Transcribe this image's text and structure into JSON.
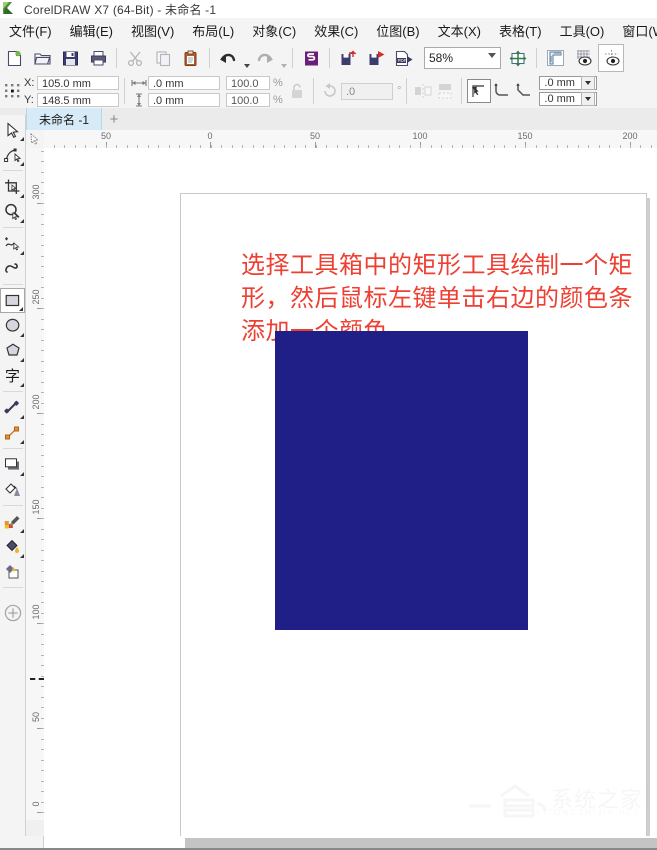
{
  "window": {
    "title": "CorelDRAW X7 (64-Bit) - 未命名 -1",
    "logo_icon": "coreldraw-logo-icon"
  },
  "menubar": {
    "items": [
      {
        "label": "文件(F)",
        "name": "menu-file"
      },
      {
        "label": "编辑(E)",
        "name": "menu-edit"
      },
      {
        "label": "视图(V)",
        "name": "menu-view"
      },
      {
        "label": "布局(L)",
        "name": "menu-layout"
      },
      {
        "label": "对象(C)",
        "name": "menu-object"
      },
      {
        "label": "效果(C)",
        "name": "menu-effects"
      },
      {
        "label": "位图(B)",
        "name": "menu-bitmap"
      },
      {
        "label": "文本(X)",
        "name": "menu-text"
      },
      {
        "label": "表格(T)",
        "name": "menu-table"
      },
      {
        "label": "工具(O)",
        "name": "menu-tools"
      },
      {
        "label": "窗口(W)",
        "name": "menu-window"
      }
    ]
  },
  "toolbar": {
    "new_icon": "new-document-icon",
    "open_icon": "open-folder-icon",
    "save_icon": "save-floppy-icon",
    "print_icon": "print-icon",
    "cut_icon": "scissors-icon",
    "copy_icon": "copy-icon",
    "paste_icon": "paste-clipboard-icon",
    "undo_icon": "undo-arrow-icon",
    "redo_icon": "redo-arrow-icon",
    "corel_connect_icon": "corel-connect-icon",
    "import_icon": "import-icon",
    "export_icon": "export-icon",
    "publish_pdf_icon": "publish-to-pdf-icon",
    "zoom_value": "58%",
    "zoom_placeholder": "58%",
    "fullscreen_icon": "zoom-levels-icon",
    "options_icon": "options-ruler-icon",
    "grid_icon": "show-grid-icon",
    "snap_icon": "snap-to-icon"
  },
  "propertybar": {
    "position_icon": "object-position-icon",
    "x_label": "X:",
    "x_value": "105.0 mm",
    "y_label": "Y:",
    "y_value": "148.5 mm",
    "width_icon": "object-width-icon",
    "width_value": ".0 mm",
    "height_icon": "object-height-icon",
    "height_value": ".0 mm",
    "scale_x_value": "100.0",
    "scale_y_value": "100.0",
    "percent_symbol": "%",
    "lock_ratio_icon": "lock-ratio-icon",
    "rotate_icon": "rotation-angle-icon",
    "rotate_value": ".0",
    "degree_symbol": "°",
    "mirror_h_icon": "mirror-horizontal-icon",
    "mirror_v_icon": "mirror-vertical-icon",
    "corner_square_icon": "square-corner-icon",
    "corner_round_icon": "round-corner-icon",
    "corner_chamfer_icon": "chamfer-corner-icon",
    "corner_radius_1": ".0 mm",
    "corner_radius_2": ".0 mm"
  },
  "tabbar": {
    "active_tab": "未命名 -1",
    "new_tab_label": "+"
  },
  "toolbox": {
    "items": [
      {
        "name": "tool-pick",
        "icon": "pick-arrow-icon",
        "flyout": true,
        "active": false
      },
      {
        "name": "tool-shape",
        "icon": "shape-node-edit-icon",
        "flyout": true,
        "active": false
      },
      {
        "name": "tool-crop",
        "icon": "crop-icon",
        "flyout": true,
        "active": false
      },
      {
        "name": "tool-zoom",
        "icon": "magnifier-icon",
        "flyout": true,
        "active": false
      },
      {
        "name": "tool-freehand",
        "icon": "freehand-curve-icon",
        "flyout": true,
        "active": false
      },
      {
        "name": "tool-artistic-media",
        "icon": "artistic-media-icon",
        "flyout": false,
        "active": false
      },
      {
        "name": "tool-rectangle",
        "icon": "rectangle-icon",
        "flyout": true,
        "active": true
      },
      {
        "name": "tool-ellipse",
        "icon": "ellipse-icon",
        "flyout": true,
        "active": false
      },
      {
        "name": "tool-polygon",
        "icon": "polygon-icon",
        "flyout": true,
        "active": false
      },
      {
        "name": "tool-text",
        "icon": "text-icon",
        "flyout": true,
        "active": false
      },
      {
        "name": "tool-dimension",
        "icon": "dimension-icon",
        "flyout": true,
        "active": false
      },
      {
        "name": "tool-connector",
        "icon": "connector-line-icon",
        "flyout": true,
        "active": false
      },
      {
        "name": "tool-shadow",
        "icon": "drop-shadow-icon",
        "flyout": true,
        "active": false
      },
      {
        "name": "tool-transparency",
        "icon": "transparency-icon",
        "flyout": false,
        "active": false
      },
      {
        "name": "tool-color-eyedropper",
        "icon": "eyedropper-icon",
        "flyout": true,
        "active": false
      },
      {
        "name": "tool-fill",
        "icon": "fill-bucket-icon",
        "flyout": true,
        "active": false
      },
      {
        "name": "tool-interactive-fill",
        "icon": "interactive-fill-icon",
        "flyout": false,
        "active": false
      },
      {
        "name": "tool-add-more",
        "icon": "circle-plus-icon",
        "flyout": false,
        "active": false
      }
    ]
  },
  "rulers": {
    "unit": "mm",
    "horizontal_labels": [
      "50",
      "0",
      "50",
      "100",
      "150",
      "200"
    ],
    "horizontal_positions": [
      62,
      166,
      271,
      376,
      481,
      586
    ],
    "vertical_labels": [
      "300",
      "250",
      "200",
      "150",
      "100",
      "50",
      "0"
    ],
    "vertical_positions": [
      55,
      160,
      265,
      370,
      475,
      580,
      664
    ]
  },
  "document": {
    "note": "选择工具箱中的矩形工具绘制一个矩形，然后鼠标左键单击右边的颜色条添加一个颜色",
    "note_color": "#ee3f33",
    "rectangle_fill": "#201f87",
    "page_background": "#ffffff"
  },
  "watermark": {
    "text": "系统之家",
    "subtext": "XITONGZHIJIA.NET"
  },
  "scrollbar": {
    "horizontal_name": "horizontal-scrollbar"
  }
}
